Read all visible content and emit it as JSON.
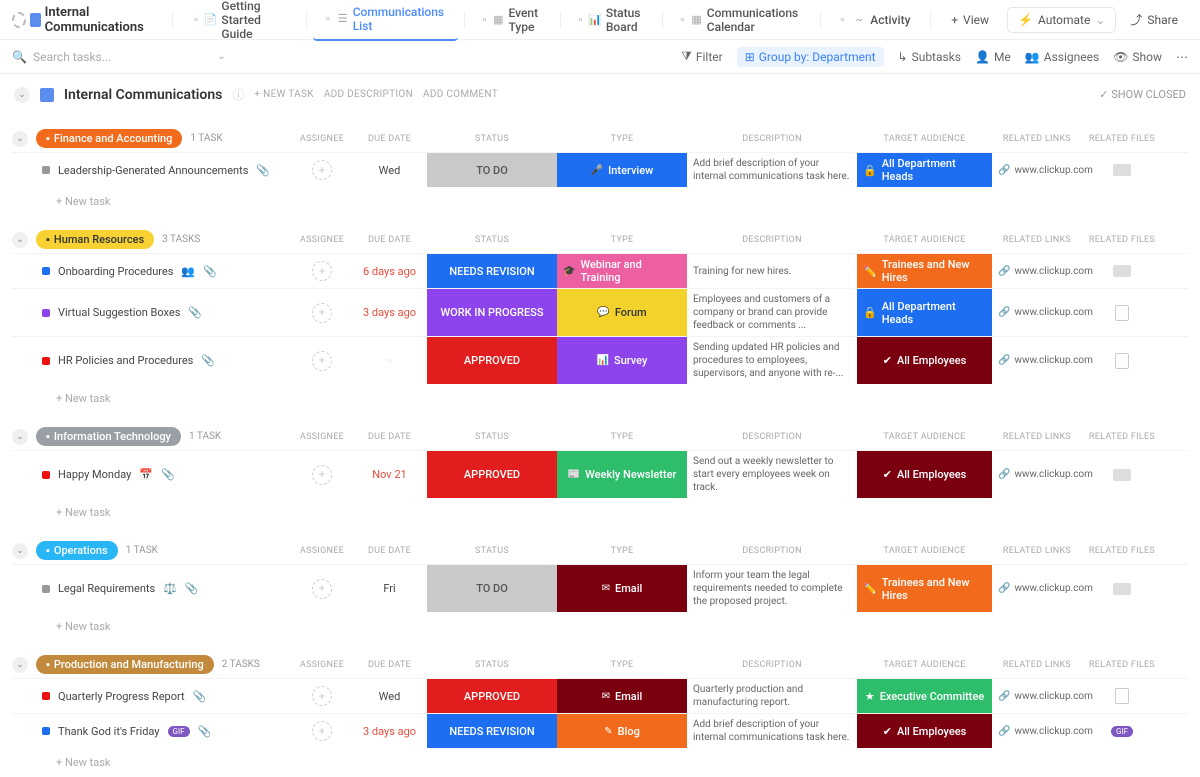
{
  "workspace": "Internal Communications",
  "tabs": [
    {
      "label": "Getting Started Guide"
    },
    {
      "label": "Communications List",
      "active": true
    },
    {
      "label": "Event Type"
    },
    {
      "label": "Status Board"
    },
    {
      "label": "Communications Calendar"
    },
    {
      "label": "Activity"
    }
  ],
  "view_btn": "View",
  "automate": "Automate",
  "share": "Share",
  "search_placeholder": "Search tasks...",
  "tools": {
    "filter": "Filter",
    "group": "Group by: Department",
    "subtasks": "Subtasks",
    "me": "Me",
    "assignees": "Assignees",
    "show": "Show"
  },
  "page": {
    "title": "Internal Communications",
    "new_task": "+ NEW TASK",
    "add_desc": "ADD DESCRIPTION",
    "add_comment": "ADD COMMENT",
    "show_closed": "SHOW CLOSED"
  },
  "columns": [
    "ASSIGNEE",
    "DUE DATE",
    "STATUS",
    "TYPE",
    "DESCRIPTION",
    "TARGET AUDIENCE",
    "RELATED LINKS",
    "RELATED FILES"
  ],
  "new_task_row": "+ New task",
  "link_text": "www.clickup.com",
  "groups": [
    {
      "name": "Finance and Accounting",
      "color": "#f26b1d",
      "count": "1 TASK",
      "rows": [
        {
          "sq": "#999",
          "name": "Leadership-Generated Announcements",
          "due": "Wed",
          "due_red": false,
          "status": "TO DO",
          "status_bg": "#c9c9c9",
          "status_fg": "#555",
          "type": "Interview",
          "type_bg": "#1d6ef0",
          "type_icon": "🎤",
          "desc": "Add brief description of your internal communications task here.",
          "aud": "All Department Heads",
          "aud_bg": "#1d6ef0",
          "aud_icon": "🔒",
          "file": "img"
        }
      ]
    },
    {
      "name": "Human Resources",
      "color": "#f7d232",
      "fg": "#333",
      "count": "3 TASKS",
      "rows": [
        {
          "sq": "#1d6ef0",
          "name": "Onboarding Procedures",
          "extra": "👥",
          "due": "6 days ago",
          "due_red": true,
          "status": "NEEDS REVISION",
          "status_bg": "#1d6ef0",
          "type": "Webinar and Training",
          "type_bg": "#ec5fa1",
          "type_icon": "🎓",
          "desc": "Training for new hires.",
          "aud": "Trainees and New Hires",
          "aud_bg": "#f26b1d",
          "aud_icon": "✏️",
          "file": "img"
        },
        {
          "sq": "#8e44ec",
          "name": "Virtual Suggestion Boxes",
          "due": "3 days ago",
          "due_red": true,
          "status": "WORK IN PROGRESS",
          "status_bg": "#8e44ec",
          "type": "Forum",
          "type_bg": "#f3d22b",
          "type_fg": "#333",
          "type_icon": "💬",
          "desc": "Employees and customers of a company or brand can provide feedback or comments ...",
          "aud": "All Department Heads",
          "aud_bg": "#1d6ef0",
          "aud_icon": "🔒",
          "file": "doc"
        },
        {
          "sq": "#e11",
          "name": "HR Policies and Procedures",
          "due": "",
          "status": "APPROVED",
          "status_bg": "#e11d1d",
          "type": "Survey",
          "type_bg": "#8e44ec",
          "type_icon": "📊",
          "desc": "Sending updated HR policies and procedures to employees, supervisors, and anyone with re-...",
          "aud": "All Employees",
          "aud_bg": "#7a0010",
          "aud_icon": "✔",
          "file": "doc"
        }
      ]
    },
    {
      "name": "Information Technology",
      "color": "#9aa0a6",
      "count": "1 TASK",
      "rows": [
        {
          "sq": "#e11",
          "name": "Happy Monday",
          "extra": "📅",
          "due": "Nov 21",
          "due_red": true,
          "status": "APPROVED",
          "status_bg": "#e11d1d",
          "type": "Weekly Newsletter",
          "type_bg": "#2ebd6b",
          "type_icon": "📰",
          "desc": "Send out a weekly newsletter to start every employees week on track.",
          "aud": "All Employees",
          "aud_bg": "#7a0010",
          "aud_icon": "✔",
          "file": "img"
        }
      ]
    },
    {
      "name": "Operations",
      "color": "#29b6f6",
      "count": "1 TASK",
      "rows": [
        {
          "sq": "#999",
          "name": "Legal Requirements",
          "extra": "⚖️",
          "due": "Fri",
          "due_red": false,
          "status": "TO DO",
          "status_bg": "#c9c9c9",
          "status_fg": "#555",
          "type": "Email",
          "type_bg": "#7a0010",
          "type_icon": "✉",
          "desc": "Inform your team the legal requirements needed to complete the proposed project.",
          "aud": "Trainees and New Hires",
          "aud_bg": "#f26b1d",
          "aud_icon": "✏️",
          "file": "img"
        }
      ]
    },
    {
      "name": "Production and Manufacturing",
      "color": "#c28a3d",
      "count": "2 TASKS",
      "rows": [
        {
          "sq": "#e11",
          "name": "Quarterly Progress Report",
          "due": "Wed",
          "due_red": false,
          "status": "APPROVED",
          "status_bg": "#e11d1d",
          "type": "Email",
          "type_bg": "#7a0010",
          "type_icon": "✉",
          "desc": "Quarterly production and manufacturing report.",
          "aud": "Executive Committee",
          "aud_bg": "#2ebd6b",
          "aud_icon": "★",
          "file": "doc"
        },
        {
          "sq": "#1d6ef0",
          "name": "Thank God it's Friday",
          "badge": "GIF",
          "due": "3 days ago",
          "due_red": true,
          "status": "NEEDS REVISION",
          "status_bg": "#1d6ef0",
          "type": "Blog",
          "type_bg": "#f26b1d",
          "type_icon": "✎",
          "desc": "Add brief description of your internal communications task here.",
          "aud": "All Employees",
          "aud_bg": "#7a0010",
          "aud_icon": "✔",
          "file": "badge"
        }
      ]
    }
  ]
}
